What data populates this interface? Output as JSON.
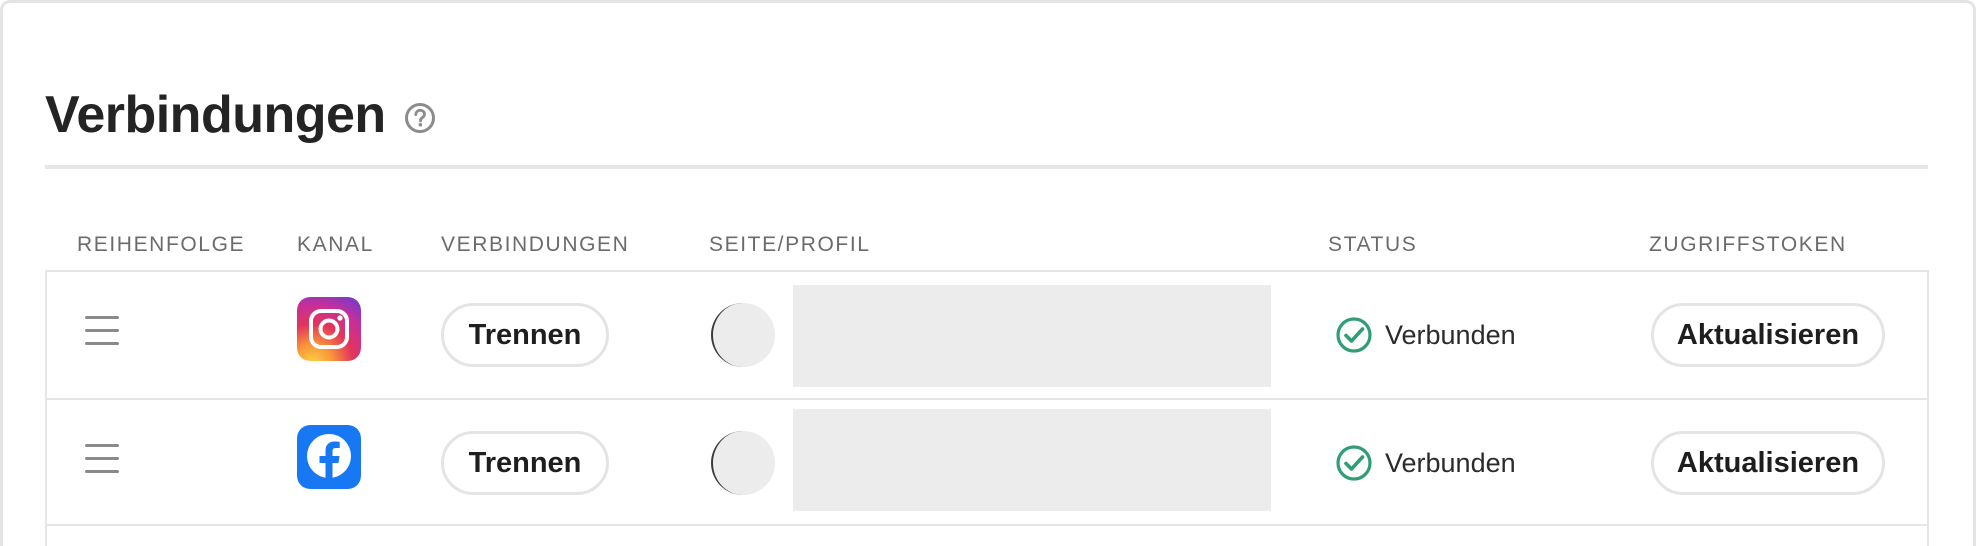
{
  "section": {
    "title": "Verbindungen",
    "help_icon": "question-circle-icon"
  },
  "columns": {
    "order": "REIHENFOLGE",
    "channel": "KANAL",
    "connections": "VERBINDUNGEN",
    "page_profile": "SEITE/PROFIL",
    "status": "STATUS",
    "access_token": "ZUGRIFFSTOKEN"
  },
  "rows": [
    {
      "channel": "Instagram",
      "channel_icon": "instagram-icon",
      "disconnect_label": "Trennen",
      "status": "Verbunden",
      "status_icon": "check-circle-icon",
      "refresh_label": "Aktualisieren"
    },
    {
      "channel": "Facebook",
      "channel_icon": "facebook-icon",
      "disconnect_label": "Trennen",
      "status": "Verbunden",
      "status_icon": "check-circle-icon",
      "refresh_label": "Aktualisieren"
    }
  ],
  "colors": {
    "status_ok": "#2e9e74",
    "facebook_blue": "#1877f2",
    "border": "#e4e4e4"
  }
}
